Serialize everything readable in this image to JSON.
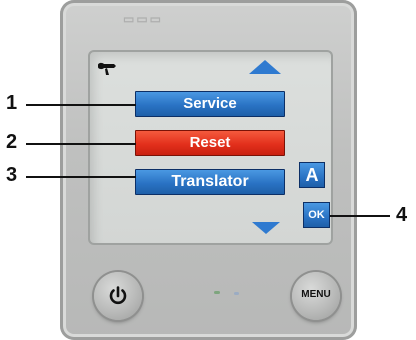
{
  "menu": {
    "items": [
      {
        "label": "Service"
      },
      {
        "label": "Reset"
      },
      {
        "label": "Translator"
      }
    ]
  },
  "side_buttons": {
    "a_label": "A",
    "ok_label": "OK"
  },
  "physical_buttons": {
    "menu_label": "MENU"
  },
  "callouts": [
    "1",
    "2",
    "3",
    "4"
  ],
  "icons": [
    "wrench-icon",
    "arrow-up-icon",
    "arrow-down-icon",
    "power-icon"
  ],
  "colors": {
    "button_blue": "#2a73c4",
    "button_red": "#e3301c",
    "screen": "#d8dbd9"
  }
}
